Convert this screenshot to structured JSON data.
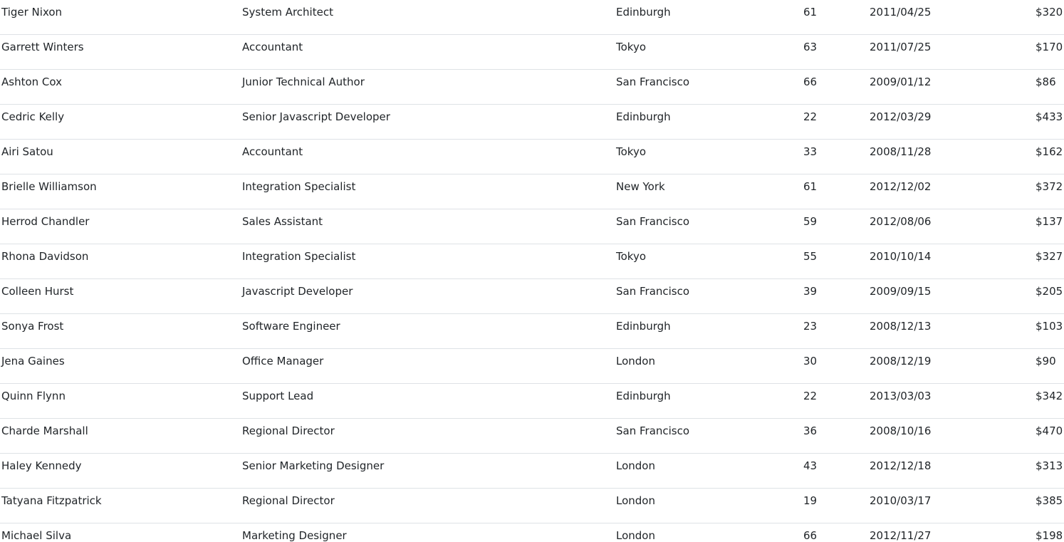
{
  "table": {
    "rows": [
      {
        "name": "Tiger Nixon",
        "position": "System Architect",
        "office": "Edinburgh",
        "age": "61",
        "start_date": "2011/04/25",
        "salary": "$320"
      },
      {
        "name": "Garrett Winters",
        "position": "Accountant",
        "office": "Tokyo",
        "age": "63",
        "start_date": "2011/07/25",
        "salary": "$170"
      },
      {
        "name": "Ashton Cox",
        "position": "Junior Technical Author",
        "office": "San Francisco",
        "age": "66",
        "start_date": "2009/01/12",
        "salary": "$86"
      },
      {
        "name": "Cedric Kelly",
        "position": "Senior Javascript Developer",
        "office": "Edinburgh",
        "age": "22",
        "start_date": "2012/03/29",
        "salary": "$433"
      },
      {
        "name": "Airi Satou",
        "position": "Accountant",
        "office": "Tokyo",
        "age": "33",
        "start_date": "2008/11/28",
        "salary": "$162"
      },
      {
        "name": "Brielle Williamson",
        "position": "Integration Specialist",
        "office": "New York",
        "age": "61",
        "start_date": "2012/12/02",
        "salary": "$372"
      },
      {
        "name": "Herrod Chandler",
        "position": "Sales Assistant",
        "office": "San Francisco",
        "age": "59",
        "start_date": "2012/08/06",
        "salary": "$137"
      },
      {
        "name": "Rhona Davidson",
        "position": "Integration Specialist",
        "office": "Tokyo",
        "age": "55",
        "start_date": "2010/10/14",
        "salary": "$327"
      },
      {
        "name": "Colleen Hurst",
        "position": "Javascript Developer",
        "office": "San Francisco",
        "age": "39",
        "start_date": "2009/09/15",
        "salary": "$205"
      },
      {
        "name": "Sonya Frost",
        "position": "Software Engineer",
        "office": "Edinburgh",
        "age": "23",
        "start_date": "2008/12/13",
        "salary": "$103"
      },
      {
        "name": "Jena Gaines",
        "position": "Office Manager",
        "office": "London",
        "age": "30",
        "start_date": "2008/12/19",
        "salary": "$90"
      },
      {
        "name": "Quinn Flynn",
        "position": "Support Lead",
        "office": "Edinburgh",
        "age": "22",
        "start_date": "2013/03/03",
        "salary": "$342"
      },
      {
        "name": "Charde Marshall",
        "position": "Regional Director",
        "office": "San Francisco",
        "age": "36",
        "start_date": "2008/10/16",
        "salary": "$470"
      },
      {
        "name": "Haley Kennedy",
        "position": "Senior Marketing Designer",
        "office": "London",
        "age": "43",
        "start_date": "2012/12/18",
        "salary": "$313"
      },
      {
        "name": "Tatyana Fitzpatrick",
        "position": "Regional Director",
        "office": "London",
        "age": "19",
        "start_date": "2010/03/17",
        "salary": "$385"
      },
      {
        "name": "Michael Silva",
        "position": "Marketing Designer",
        "office": "London",
        "age": "66",
        "start_date": "2012/11/27",
        "salary": "$198"
      }
    ]
  }
}
